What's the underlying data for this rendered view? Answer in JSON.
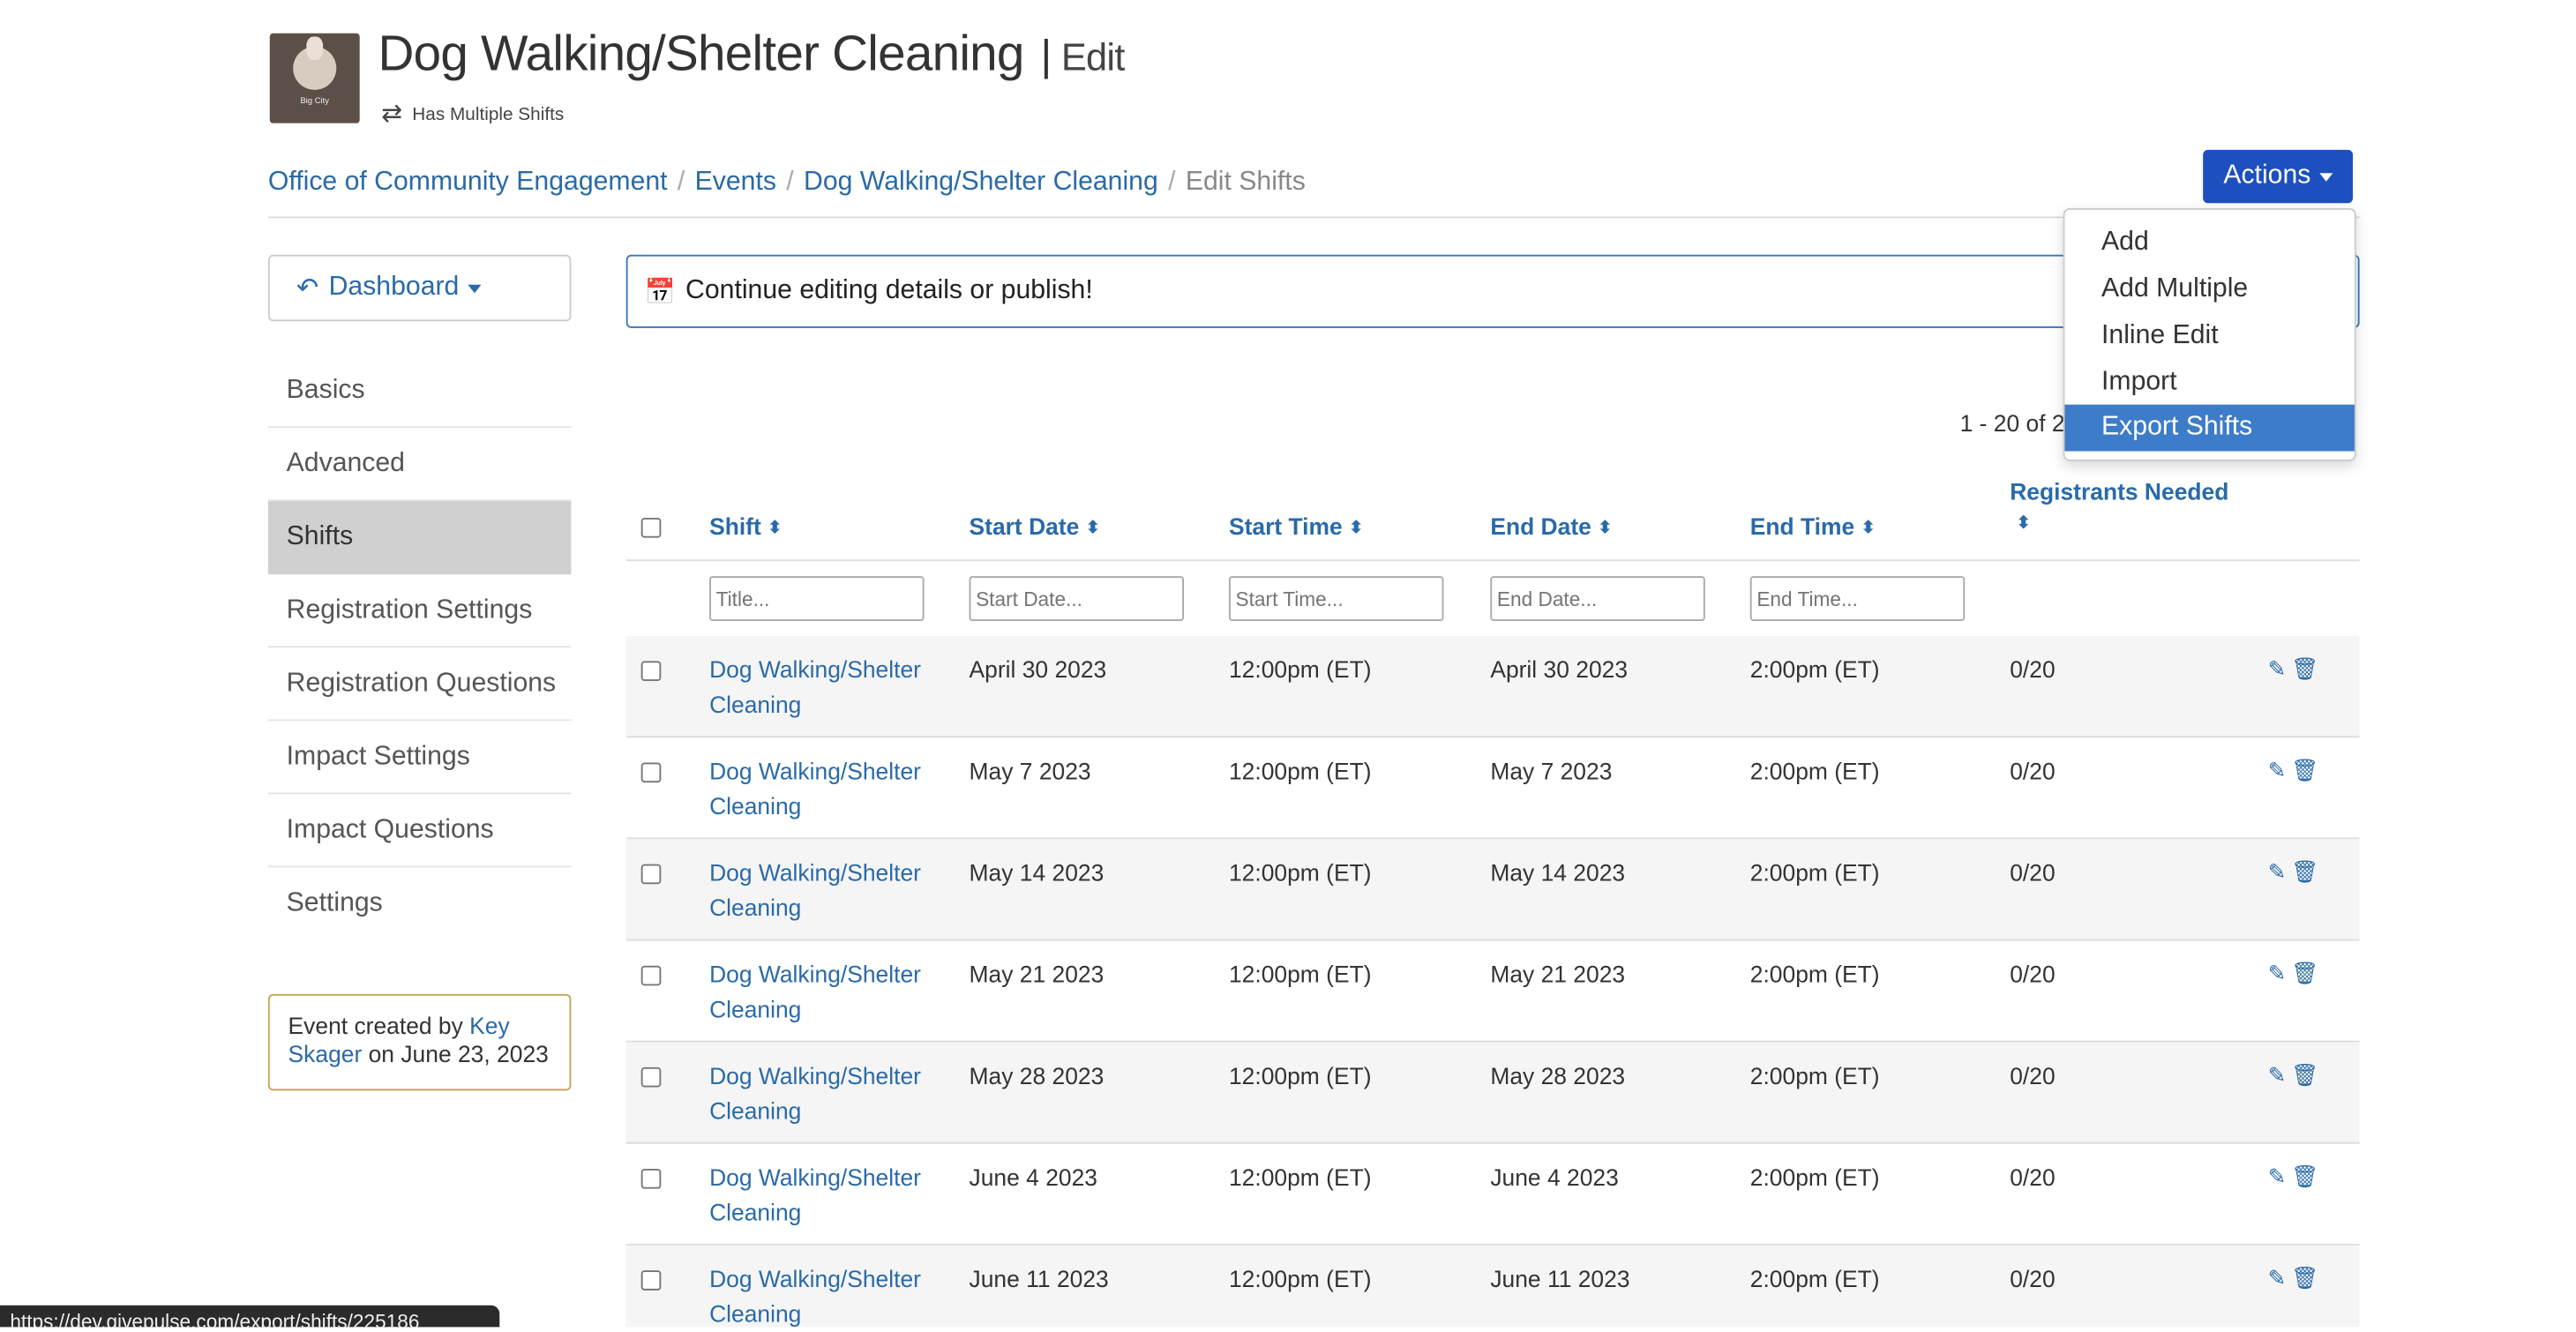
{
  "header": {
    "title": "Dog Walking/Shelter Cleaning",
    "separator": "|",
    "edit_label": "Edit",
    "multi_shift_label": "Has Multiple Shifts",
    "logo_text": "Big City"
  },
  "breadcrumb": {
    "items": [
      "Office of Community Engagement",
      "Events",
      "Dog Walking/Shelter Cleaning"
    ],
    "current": "Edit Shifts"
  },
  "actions": {
    "button_label": "Actions",
    "menu": [
      "Add",
      "Add Multiple",
      "Inline Edit",
      "Import",
      "Export Shifts"
    ],
    "highlighted": "Export Shifts"
  },
  "sidebar": {
    "dashboard_label": "Dashboard",
    "items": [
      "Basics",
      "Advanced",
      "Shifts",
      "Registration Settings",
      "Registration Questions",
      "Impact Settings",
      "Impact Questions",
      "Settings"
    ],
    "active": "Shifts",
    "created_prefix": "Event created by",
    "created_user": "Key Skager",
    "created_suffix": "on June 23, 2023"
  },
  "notice": {
    "text": "Continue editing details or publish!"
  },
  "pager": {
    "text": "1 - 20 of 2"
  },
  "table": {
    "headers": {
      "shift": "Shift",
      "start_date": "Start Date",
      "start_time": "Start Time",
      "end_date": "End Date",
      "end_time": "End Time",
      "registrants": "Registrants Needed"
    },
    "filters": {
      "title": "Title...",
      "start_date": "Start Date...",
      "start_time": "Start Time...",
      "end_date": "End Date...",
      "end_time": "End Time..."
    },
    "rows": [
      {
        "shift": "Dog Walking/Shelter Cleaning",
        "start_date": "April 30 2023",
        "start_time": "12:00pm (ET)",
        "end_date": "April 30 2023",
        "end_time": "2:00pm (ET)",
        "registrants": "0/20"
      },
      {
        "shift": "Dog Walking/Shelter Cleaning",
        "start_date": "May 7 2023",
        "start_time": "12:00pm (ET)",
        "end_date": "May 7 2023",
        "end_time": "2:00pm (ET)",
        "registrants": "0/20"
      },
      {
        "shift": "Dog Walking/Shelter Cleaning",
        "start_date": "May 14 2023",
        "start_time": "12:00pm (ET)",
        "end_date": "May 14 2023",
        "end_time": "2:00pm (ET)",
        "registrants": "0/20"
      },
      {
        "shift": "Dog Walking/Shelter Cleaning",
        "start_date": "May 21 2023",
        "start_time": "12:00pm (ET)",
        "end_date": "May 21 2023",
        "end_time": "2:00pm (ET)",
        "registrants": "0/20"
      },
      {
        "shift": "Dog Walking/Shelter Cleaning",
        "start_date": "May 28 2023",
        "start_time": "12:00pm (ET)",
        "end_date": "May 28 2023",
        "end_time": "2:00pm (ET)",
        "registrants": "0/20"
      },
      {
        "shift": "Dog Walking/Shelter Cleaning",
        "start_date": "June 4 2023",
        "start_time": "12:00pm (ET)",
        "end_date": "June 4 2023",
        "end_time": "2:00pm (ET)",
        "registrants": "0/20"
      },
      {
        "shift": "Dog Walking/Shelter Cleaning",
        "start_date": "June 11 2023",
        "start_time": "12:00pm (ET)",
        "end_date": "June 11 2023",
        "end_time": "2:00pm (ET)",
        "registrants": "0/20"
      }
    ]
  },
  "status_bar": {
    "url": "https://dev.givepulse.com/export/shifts/225186"
  },
  "colors": {
    "primary_button": "#1d4fbf",
    "link": "#2a6aa8",
    "menu_highlight": "#3d7cc9",
    "created_border": "#c9a35a"
  }
}
